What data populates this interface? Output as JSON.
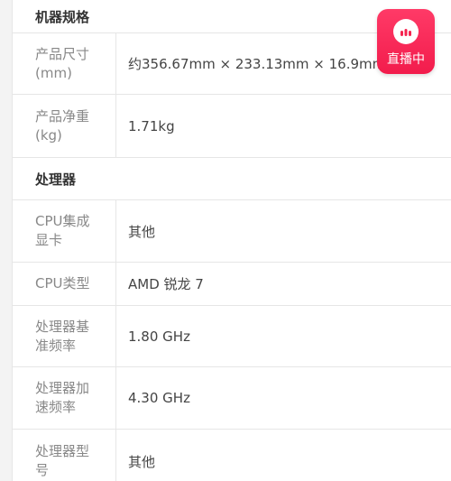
{
  "sections": [
    {
      "title": "机器规格",
      "rows": [
        {
          "label": "产品尺寸\n(mm)",
          "value": "约356.67mm × 233.13mm × 16.9mm"
        },
        {
          "label": "产品净重\n(kg)",
          "value": "1.71kg"
        }
      ]
    },
    {
      "title": "处理器",
      "rows": [
        {
          "label": "CPU集成\n显卡",
          "value": "其他"
        },
        {
          "label": "CPU类型",
          "value": "AMD 锐龙 7"
        },
        {
          "label": "处理器基\n准频率",
          "value": "1.80 GHz"
        },
        {
          "label": "处理器加\n速频率",
          "value": "4.30 GHz"
        },
        {
          "label": "处理器型\n号",
          "value": "其他"
        }
      ]
    }
  ],
  "live_badge": {
    "label": "直播中",
    "icon": "live-bars-icon",
    "color": "#f5234f"
  }
}
